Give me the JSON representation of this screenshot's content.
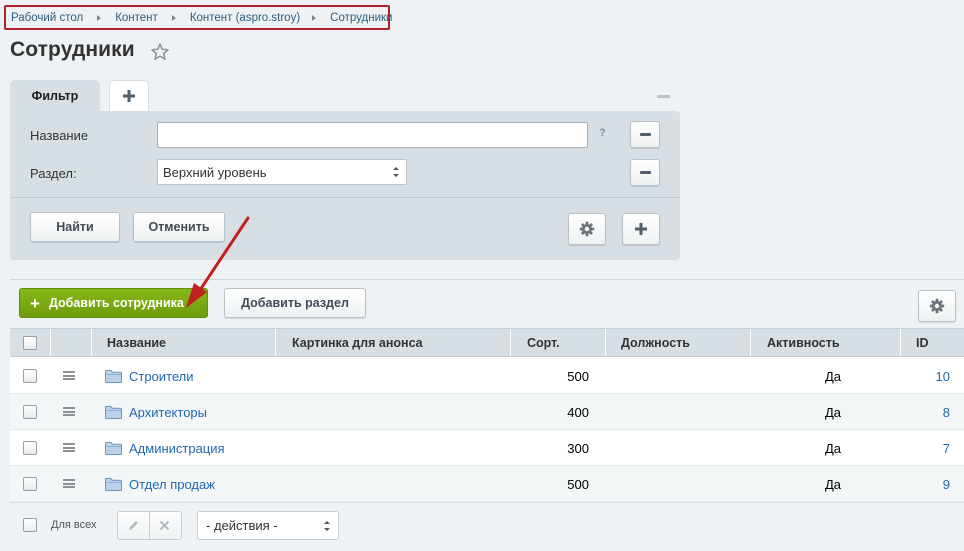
{
  "breadcrumb": [
    "Рабочий стол",
    "Контент",
    "Контент (aspro.stroy)",
    "Сотрудники"
  ],
  "page_title": "Сотрудники",
  "filter": {
    "tab_label": "Фильтр",
    "name_label": "Название",
    "name_value": "",
    "help": "?",
    "section_label": "Раздел:",
    "section_value": "Верхний уровень",
    "find_button": "Найти",
    "cancel_button": "Отменить"
  },
  "toolbar": {
    "add_employee": "Добавить сотрудника",
    "add_section": "Добавить раздел"
  },
  "table": {
    "columns": [
      "Название",
      "Картинка для анонса",
      "Сорт.",
      "Должность",
      "Активность",
      "ID"
    ],
    "rows": [
      {
        "name": "Строители",
        "sort": "500",
        "active": "Да",
        "id": "10"
      },
      {
        "name": "Архитекторы",
        "sort": "400",
        "active": "Да",
        "id": "8"
      },
      {
        "name": "Администрация",
        "sort": "300",
        "active": "Да",
        "id": "7"
      },
      {
        "name": "Отдел продаж",
        "sort": "500",
        "active": "Да",
        "id": "9"
      }
    ]
  },
  "footer": {
    "for_all": "Для всех",
    "actions_value": "- действия -"
  },
  "colors": {
    "accent_green": "#7aab14",
    "link": "#2067b0",
    "highlight_red": "#b0232a"
  }
}
